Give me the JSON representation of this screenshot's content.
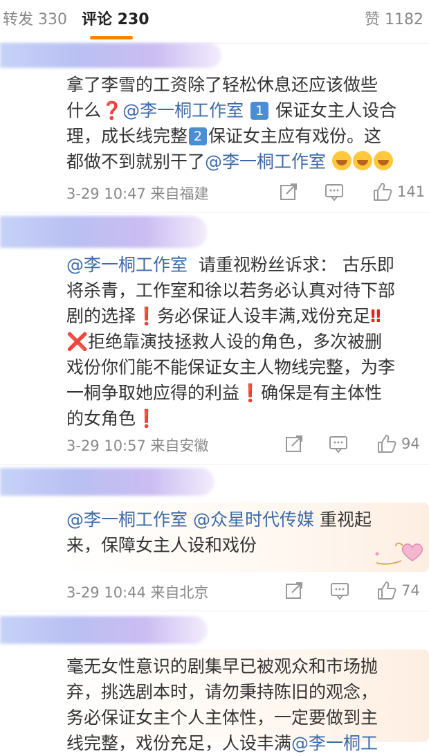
{
  "tabs": {
    "repost": "转发 330",
    "comment": "评论 230",
    "like": "赞 1182"
  },
  "comments": [
    {
      "line1": "拿了李雪的工资除了轻松休息还应该做些",
      "l2a": "什么",
      "l2m": "@李一桐工作室",
      "badge1": "1",
      "l2b": "保证女主人设合",
      "l3a": "理，成长线完整",
      "badge2": "2",
      "l3b": "保证女主应有戏份。这",
      "l4a": "都做不到就别干了",
      "l4m": "@李一桐工作室",
      "time": "3-29 10:47 来自福建",
      "likes": "141"
    },
    {
      "l1m": "@李一桐工作室",
      "l1b": "请重视粉丝诉求： 古乐即",
      "line2": "将杀青，工作室和徐以若务必认真对待下部",
      "l3a": "剧的选择",
      "l3b": "务必保证人设丰满,戏份充足",
      "l4b": "拒绝靠演技拯救人设的角色，多次被删",
      "line5": "戏份你们能不能保证女主人物线完整，为李",
      "l6a": "一桐争取她应得的利益",
      "l6b": "确保是有主体性",
      "l7a": "的女角色",
      "time": "3-29 10:57 来自安徽",
      "likes": "94"
    },
    {
      "m1": "@李一桐工作室",
      "m2": "@众星时代传媒",
      "l1b": "重视起",
      "line2": "来，保障女主人设和戏份",
      "time": "3-29 10:44 来自北京",
      "likes": "74"
    },
    {
      "line1": "毫无女性意识的剧集早已被观众和市场抛",
      "line2": "弃，挑选剧本时，请勿秉持陈旧的观念，",
      "line3": "务必保证女主个人主体性，一定要做到主",
      "l4a": "线完整，戏份充足，人设丰满",
      "l4m": "@李一桐工"
    }
  ],
  "colors": {
    "accent": "#ff8200",
    "mention": "#3d6aa8",
    "emoji_red": "#e0261c"
  },
  "icons": [
    "repost-icon",
    "comment-icon",
    "like-thumb-icon",
    "heart-sticker-icon"
  ]
}
